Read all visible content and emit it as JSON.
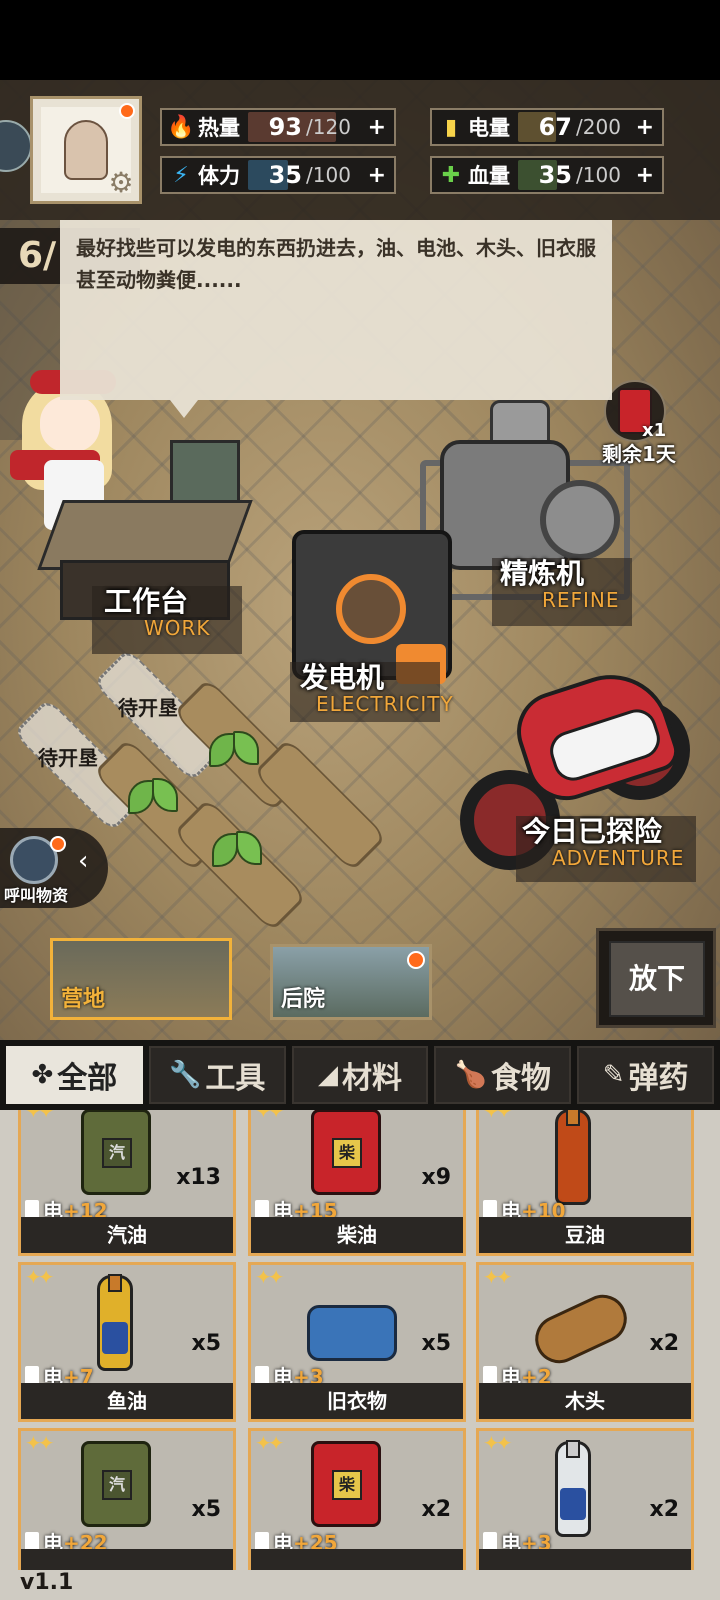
{
  "stats": {
    "heat": {
      "label": "热量",
      "value": "93",
      "max": "/120",
      "plus": "+",
      "fill": 0.775,
      "color": "#5a3a30",
      "icon_color": "#ff4a2a"
    },
    "power": {
      "label": "电量",
      "value": "67",
      "max": "/200",
      "plus": "+",
      "fill": 0.335,
      "color": "#5e5030",
      "icon_color": "#f7d34a"
    },
    "stamina": {
      "label": "体力",
      "value": "35",
      "max": "/100",
      "plus": "+",
      "fill": 0.35,
      "color": "#2c4a5e",
      "icon_color": "#3ab4f2"
    },
    "health": {
      "label": "血量",
      "value": "35",
      "max": "/100",
      "plus": "+",
      "fill": 0.35,
      "color": "#3c5030",
      "icon_color": "#6ad04a"
    }
  },
  "day_counter": "6/",
  "dialog": {
    "text": "最好找些可以发电的东西扔进去，油、电池、木头、旧衣服甚至动物粪便......"
  },
  "fuel_status": {
    "count": "x1",
    "remaining": "剩余1天"
  },
  "locations": {
    "workbench": {
      "cn": "工作台",
      "en": "WORK"
    },
    "generator": {
      "cn": "发电机",
      "en": "ELECTRICITY"
    },
    "refiner": {
      "cn": "精炼机",
      "en": "REFINE"
    },
    "adventure": {
      "cn": "今日已探险",
      "en": "ADVENTURE"
    }
  },
  "plots": {
    "locked_label_1": "待开垦",
    "locked_label_2": "待开垦"
  },
  "call_supplies": {
    "label": "呼叫物资",
    "arrow": "‹"
  },
  "area_tabs": [
    {
      "label": "营地",
      "active": true
    },
    {
      "label": "后院",
      "active": false
    }
  ],
  "put_down": "放下",
  "categories": [
    {
      "icon": "✤",
      "label": "全部",
      "active": true
    },
    {
      "icon": "🔧",
      "label": "工具",
      "active": false
    },
    {
      "icon": "◢",
      "label": "材料",
      "active": false
    },
    {
      "icon": "🍗",
      "label": "食物",
      "active": false
    },
    {
      "icon": "✎",
      "label": "弹药",
      "active": false
    }
  ],
  "items": [
    {
      "name": "汽油",
      "count": "x13",
      "power_label": "电",
      "power_add": "+12",
      "stars": "✦✦",
      "icon": "green-jerrycan",
      "can_text": "汽"
    },
    {
      "name": "柴油",
      "count": "x9",
      "power_label": "电",
      "power_add": "+15",
      "stars": "✦✦",
      "icon": "red-jerrycan",
      "can_text": "柴"
    },
    {
      "name": "豆油",
      "count": "",
      "power_label": "电",
      "power_add": "+10",
      "stars": "✦✦",
      "icon": "oil-bottle"
    },
    {
      "name": "鱼油",
      "count": "x5",
      "power_label": "电",
      "power_add": "+7",
      "stars": "✦✦",
      "icon": "fish-oil-bottle"
    },
    {
      "name": "旧衣物",
      "count": "x5",
      "power_label": "电",
      "power_add": "+3",
      "stars": "✦✦",
      "icon": "old-clothes"
    },
    {
      "name": "木头",
      "count": "x2",
      "power_label": "电",
      "power_add": "+2",
      "stars": "✦✦",
      "icon": "wood-log"
    },
    {
      "name": "",
      "count": "x5",
      "power_label": "电",
      "power_add": "+22",
      "stars": "✦✦",
      "icon": "green-jerrycan",
      "can_text": "汽"
    },
    {
      "name": "",
      "count": "x2",
      "power_label": "电",
      "power_add": "+25",
      "stars": "✦✦",
      "icon": "red-jerrycan",
      "can_text": "柴"
    },
    {
      "name": "",
      "count": "x2",
      "power_label": "电",
      "power_add": "+3",
      "stars": "✦✦",
      "icon": "glass-bottle"
    }
  ],
  "version": "v1.1"
}
